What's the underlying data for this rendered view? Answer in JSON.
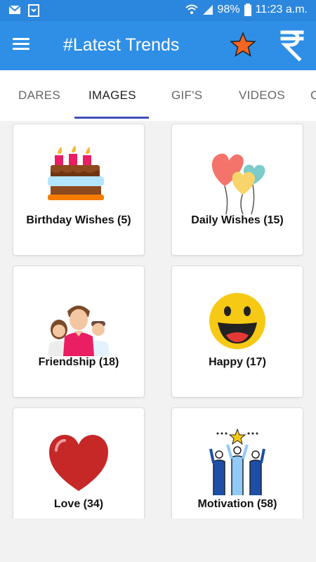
{
  "status_bar": {
    "battery": "98%",
    "time": "11:23 a.m."
  },
  "app_bar": {
    "title": "#Latest Trends"
  },
  "tabs": [
    {
      "label": "DARES",
      "active": false
    },
    {
      "label": "IMAGES",
      "active": true
    },
    {
      "label": "GIF'S",
      "active": false
    },
    {
      "label": "VIDEOS",
      "active": false
    },
    {
      "label": "C",
      "active": false
    }
  ],
  "categories": [
    {
      "label": "Birthday Wishes (5)",
      "icon": "birthday-cake-icon"
    },
    {
      "label": "Daily Wishes (15)",
      "icon": "balloons-icon"
    },
    {
      "label": "Friendship (18)",
      "icon": "friends-group-icon"
    },
    {
      "label": "Happy (17)",
      "icon": "smiley-face-icon"
    },
    {
      "label": "Love (34)",
      "icon": "heart-icon"
    },
    {
      "label": "Motivation (58)",
      "icon": "celebrating-people-icon"
    }
  ],
  "colors": {
    "status_bar": "#2b87dd",
    "app_bar": "#2f8fe6",
    "tab_indicator": "#3f51b5",
    "star": "#f26522",
    "heart": "#c62828",
    "smiley": "#f6c915"
  }
}
